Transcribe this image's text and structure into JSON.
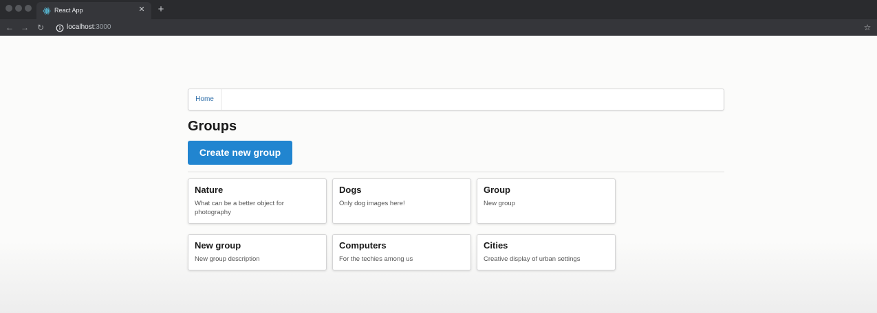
{
  "browser": {
    "tab_title": "React App",
    "url_host": "localhost",
    "url_port": ":3000"
  },
  "menu": {
    "home_label": "Home"
  },
  "page": {
    "heading": "Groups",
    "create_button_label": "Create new group"
  },
  "groups": [
    {
      "title": "Nature",
      "description": "What can be a better object for photography"
    },
    {
      "title": "Dogs",
      "description": "Only dog images here!"
    },
    {
      "title": "Group",
      "description": "New group"
    },
    {
      "title": "New group",
      "description": "New group description"
    },
    {
      "title": "Computers",
      "description": "For the techies among us"
    },
    {
      "title": "Cities",
      "description": "Creative display of urban settings"
    }
  ],
  "colors": {
    "primary_button": "#2185d0",
    "link": "#2d6da8"
  }
}
